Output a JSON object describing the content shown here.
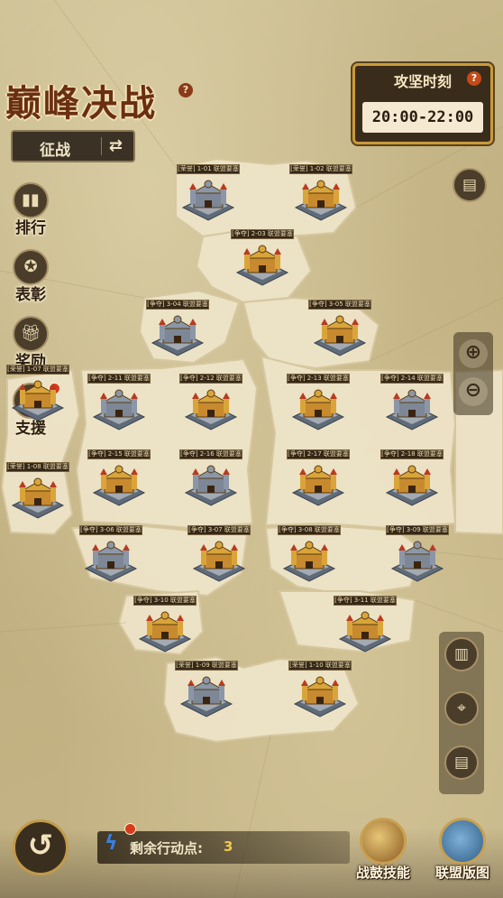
{
  "header": {
    "title": "巅峰决战",
    "help_icon": "question-icon",
    "mode_label": "征战",
    "mode_swap_icon": "swap-arrows-icon"
  },
  "siege_time": {
    "title": "攻坚时刻",
    "badge": "?",
    "time": "20:00-22:00"
  },
  "side_menu": [
    {
      "label": "排行",
      "icon": "ranking-icon"
    },
    {
      "label": "表彰",
      "icon": "medal-icon"
    },
    {
      "label": "奖励",
      "icon": "gift-icon"
    },
    {
      "label": "支援",
      "icon": "support-icon"
    }
  ],
  "right_controls": {
    "info_icon": "notice-icon",
    "zoom_in_icon": "zoom-in-icon",
    "zoom_out_icon": "zoom-out-icon",
    "map_icon": "map-icon",
    "locate_icon": "location-pin-icon",
    "notice2_icon": "notice-icon"
  },
  "fortresses": [
    {
      "tag": "[荣誉] 1-01 联盟要塞"
    },
    {
      "tag": "[荣誉] 1-02 联盟要塞"
    },
    {
      "tag": "[争夺] 2-03 联盟要塞"
    },
    {
      "tag": "[争夺] 3-04 联盟要塞"
    },
    {
      "tag": "[争夺] 3-05 联盟要塞"
    },
    {
      "tag": "[荣誉] 1-07 联盟要塞"
    },
    {
      "tag": "[争夺] 2-11 联盟要塞"
    },
    {
      "tag": "[争夺] 2-12 联盟要塞"
    },
    {
      "tag": "[争夺] 2-13 联盟要塞"
    },
    {
      "tag": "[争夺] 2-14 联盟要塞"
    },
    {
      "tag": "[荣誉] 1-08 联盟要塞"
    },
    {
      "tag": "[争夺] 2-15 联盟要塞"
    },
    {
      "tag": "[争夺] 2-16 联盟要塞"
    },
    {
      "tag": "[争夺] 2-17 联盟要塞"
    },
    {
      "tag": "[争夺] 2-18 联盟要塞"
    },
    {
      "tag": "[争夺] 3-06 联盟要塞"
    },
    {
      "tag": "[争夺] 3-07 联盟要塞"
    },
    {
      "tag": "[争夺] 3-08 联盟要塞"
    },
    {
      "tag": "[争夺] 3-09 联盟要塞"
    },
    {
      "tag": "[争夺] 3-10 联盟要塞"
    },
    {
      "tag": "[争夺] 3-11 联盟要塞"
    },
    {
      "tag": "[荣誉] 1-09 联盟要塞"
    },
    {
      "tag": "[荣誉] 1-10 联盟要塞"
    }
  ],
  "bottom": {
    "back_icon": "back-arrow-icon",
    "action_points_label": "剩余行动点:",
    "action_points_value": "3",
    "skill_label": "战鼓技能",
    "alliance_label": "联盟版图"
  }
}
